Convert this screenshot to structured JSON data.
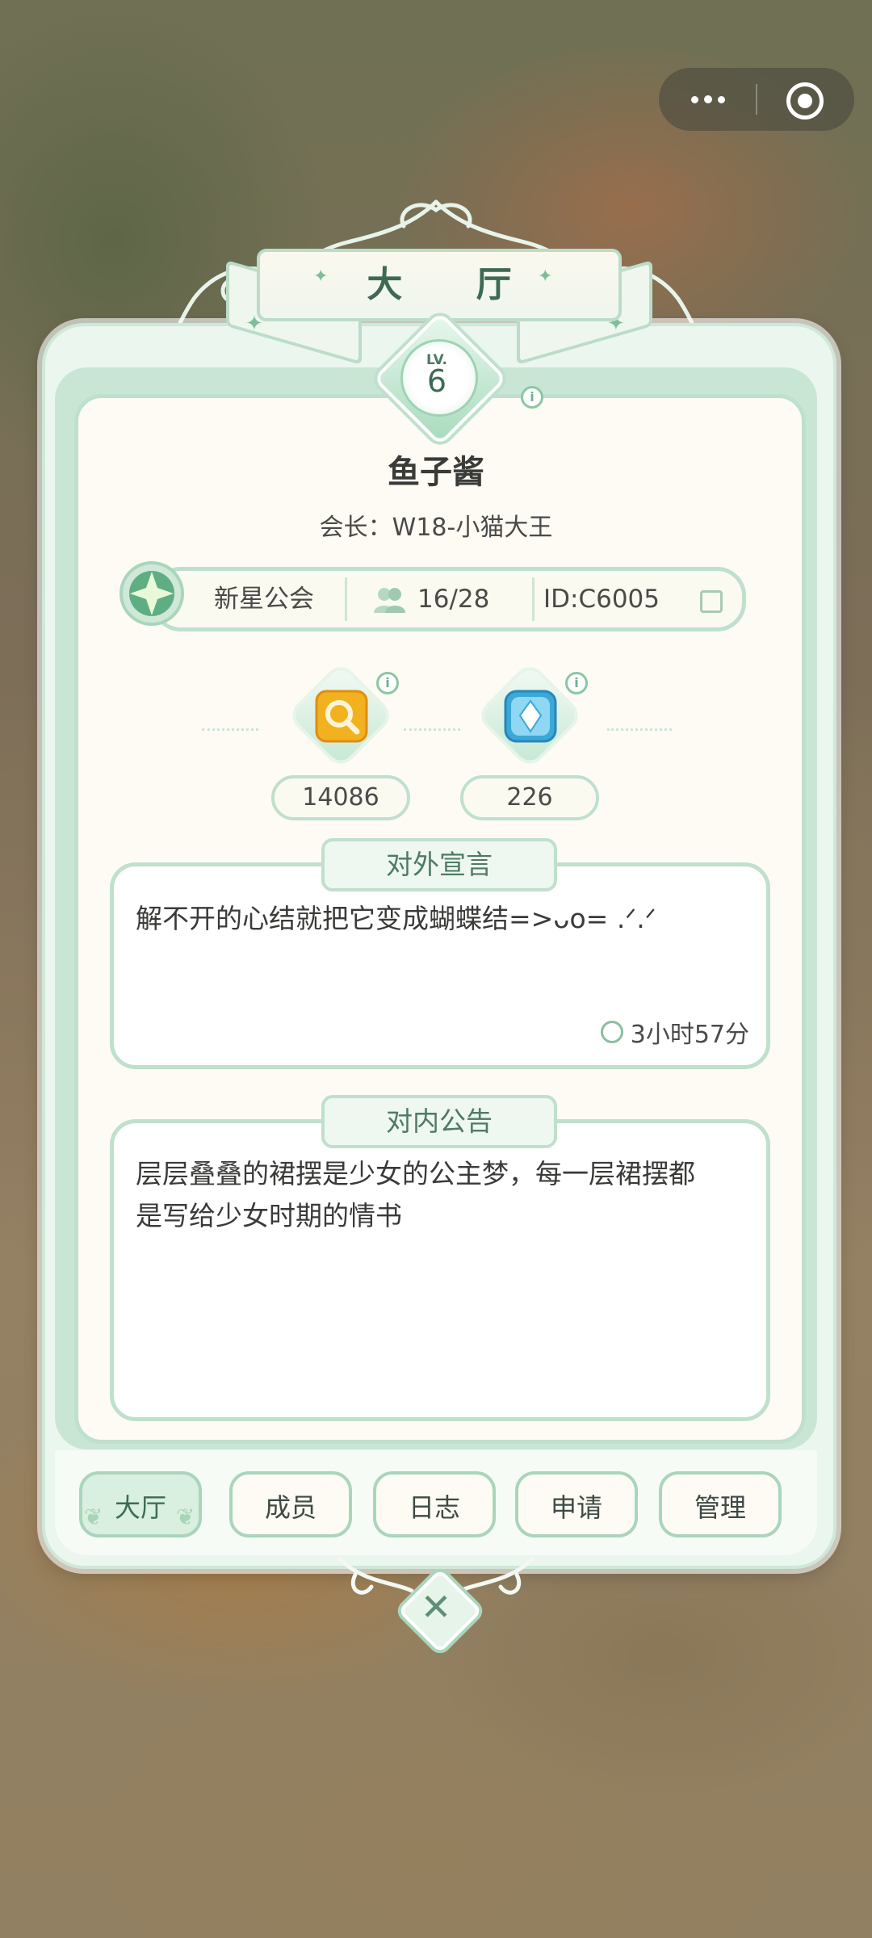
{
  "capsule": {
    "more_icon": "more-dots-icon",
    "close_icon": "target-circle-icon"
  },
  "header": {
    "title": "大 厅"
  },
  "guild": {
    "level_label": "LV.",
    "level": "6",
    "name": "鱼子酱",
    "leader": "会长：W18-小猫大王",
    "type": "新星公会",
    "members": "16/28",
    "id": "ID:C6005"
  },
  "currencies": [
    {
      "icon": "magnifier-coin-icon",
      "value": "14086",
      "color": "#f2b21f"
    },
    {
      "icon": "blue-crystal-icon",
      "value": "226",
      "color": "#3aa8d8"
    }
  ],
  "external": {
    "title": "对外宣言",
    "text": "解不开的心结就把它变成蝴蝶结=>ᴗo= .ᐟ.ᐟ",
    "time": "3小时57分"
  },
  "internal": {
    "title": "对内公告",
    "text_line1": "层层叠叠的裙摆是少女的公主梦，每一层裙摆都",
    "text_line2": "是写给少女时期的情书"
  },
  "tabs": [
    "大厅",
    "成员",
    "日志",
    "申请",
    "管理"
  ],
  "colors": {
    "accent_green": "#bfe0cc",
    "text_green": "#3e6a55",
    "panel_bg": "#fdfbf3"
  }
}
